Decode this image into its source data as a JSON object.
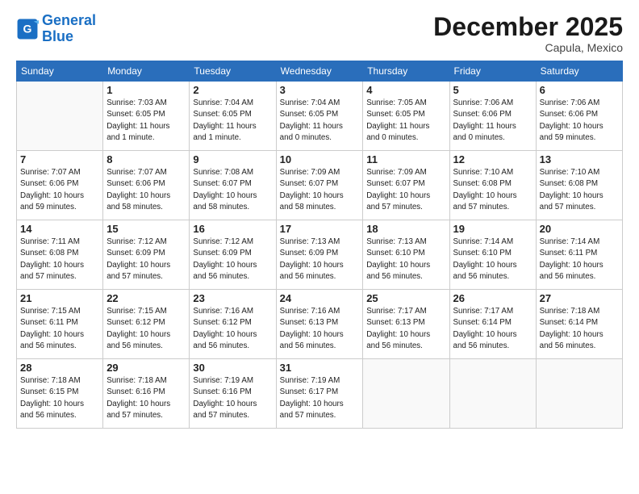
{
  "header": {
    "logo_line1": "General",
    "logo_line2": "Blue",
    "title": "December 2025",
    "location": "Capula, Mexico"
  },
  "columns": [
    "Sunday",
    "Monday",
    "Tuesday",
    "Wednesday",
    "Thursday",
    "Friday",
    "Saturday"
  ],
  "weeks": [
    [
      {
        "day": "",
        "info": ""
      },
      {
        "day": "1",
        "info": "Sunrise: 7:03 AM\nSunset: 6:05 PM\nDaylight: 11 hours\nand 1 minute."
      },
      {
        "day": "2",
        "info": "Sunrise: 7:04 AM\nSunset: 6:05 PM\nDaylight: 11 hours\nand 1 minute."
      },
      {
        "day": "3",
        "info": "Sunrise: 7:04 AM\nSunset: 6:05 PM\nDaylight: 11 hours\nand 0 minutes."
      },
      {
        "day": "4",
        "info": "Sunrise: 7:05 AM\nSunset: 6:05 PM\nDaylight: 11 hours\nand 0 minutes."
      },
      {
        "day": "5",
        "info": "Sunrise: 7:06 AM\nSunset: 6:06 PM\nDaylight: 11 hours\nand 0 minutes."
      },
      {
        "day": "6",
        "info": "Sunrise: 7:06 AM\nSunset: 6:06 PM\nDaylight: 10 hours\nand 59 minutes."
      }
    ],
    [
      {
        "day": "7",
        "info": "Sunrise: 7:07 AM\nSunset: 6:06 PM\nDaylight: 10 hours\nand 59 minutes."
      },
      {
        "day": "8",
        "info": "Sunrise: 7:07 AM\nSunset: 6:06 PM\nDaylight: 10 hours\nand 58 minutes."
      },
      {
        "day": "9",
        "info": "Sunrise: 7:08 AM\nSunset: 6:07 PM\nDaylight: 10 hours\nand 58 minutes."
      },
      {
        "day": "10",
        "info": "Sunrise: 7:09 AM\nSunset: 6:07 PM\nDaylight: 10 hours\nand 58 minutes."
      },
      {
        "day": "11",
        "info": "Sunrise: 7:09 AM\nSunset: 6:07 PM\nDaylight: 10 hours\nand 57 minutes."
      },
      {
        "day": "12",
        "info": "Sunrise: 7:10 AM\nSunset: 6:08 PM\nDaylight: 10 hours\nand 57 minutes."
      },
      {
        "day": "13",
        "info": "Sunrise: 7:10 AM\nSunset: 6:08 PM\nDaylight: 10 hours\nand 57 minutes."
      }
    ],
    [
      {
        "day": "14",
        "info": "Sunrise: 7:11 AM\nSunset: 6:08 PM\nDaylight: 10 hours\nand 57 minutes."
      },
      {
        "day": "15",
        "info": "Sunrise: 7:12 AM\nSunset: 6:09 PM\nDaylight: 10 hours\nand 57 minutes."
      },
      {
        "day": "16",
        "info": "Sunrise: 7:12 AM\nSunset: 6:09 PM\nDaylight: 10 hours\nand 56 minutes."
      },
      {
        "day": "17",
        "info": "Sunrise: 7:13 AM\nSunset: 6:09 PM\nDaylight: 10 hours\nand 56 minutes."
      },
      {
        "day": "18",
        "info": "Sunrise: 7:13 AM\nSunset: 6:10 PM\nDaylight: 10 hours\nand 56 minutes."
      },
      {
        "day": "19",
        "info": "Sunrise: 7:14 AM\nSunset: 6:10 PM\nDaylight: 10 hours\nand 56 minutes."
      },
      {
        "day": "20",
        "info": "Sunrise: 7:14 AM\nSunset: 6:11 PM\nDaylight: 10 hours\nand 56 minutes."
      }
    ],
    [
      {
        "day": "21",
        "info": "Sunrise: 7:15 AM\nSunset: 6:11 PM\nDaylight: 10 hours\nand 56 minutes."
      },
      {
        "day": "22",
        "info": "Sunrise: 7:15 AM\nSunset: 6:12 PM\nDaylight: 10 hours\nand 56 minutes."
      },
      {
        "day": "23",
        "info": "Sunrise: 7:16 AM\nSunset: 6:12 PM\nDaylight: 10 hours\nand 56 minutes."
      },
      {
        "day": "24",
        "info": "Sunrise: 7:16 AM\nSunset: 6:13 PM\nDaylight: 10 hours\nand 56 minutes."
      },
      {
        "day": "25",
        "info": "Sunrise: 7:17 AM\nSunset: 6:13 PM\nDaylight: 10 hours\nand 56 minutes."
      },
      {
        "day": "26",
        "info": "Sunrise: 7:17 AM\nSunset: 6:14 PM\nDaylight: 10 hours\nand 56 minutes."
      },
      {
        "day": "27",
        "info": "Sunrise: 7:18 AM\nSunset: 6:14 PM\nDaylight: 10 hours\nand 56 minutes."
      }
    ],
    [
      {
        "day": "28",
        "info": "Sunrise: 7:18 AM\nSunset: 6:15 PM\nDaylight: 10 hours\nand 56 minutes."
      },
      {
        "day": "29",
        "info": "Sunrise: 7:18 AM\nSunset: 6:16 PM\nDaylight: 10 hours\nand 57 minutes."
      },
      {
        "day": "30",
        "info": "Sunrise: 7:19 AM\nSunset: 6:16 PM\nDaylight: 10 hours\nand 57 minutes."
      },
      {
        "day": "31",
        "info": "Sunrise: 7:19 AM\nSunset: 6:17 PM\nDaylight: 10 hours\nand 57 minutes."
      },
      {
        "day": "",
        "info": ""
      },
      {
        "day": "",
        "info": ""
      },
      {
        "day": "",
        "info": ""
      }
    ]
  ]
}
